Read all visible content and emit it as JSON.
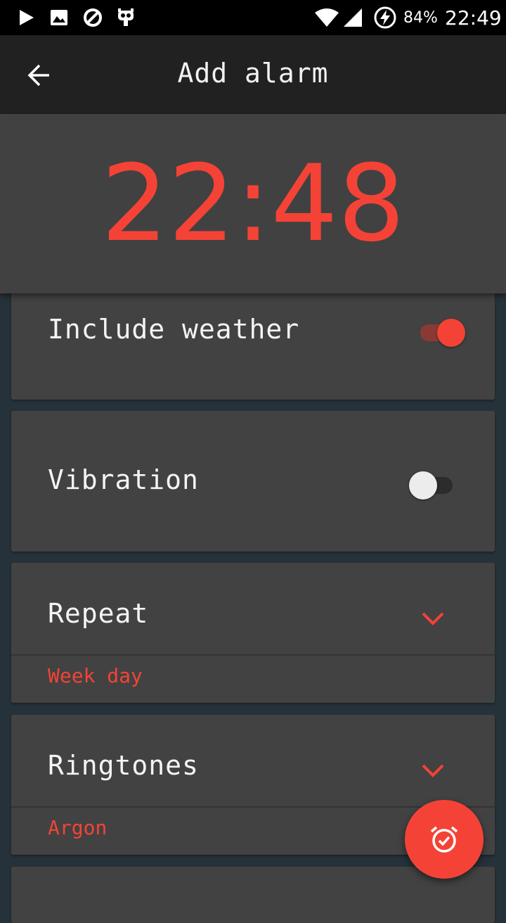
{
  "status_bar": {
    "battery": "84%",
    "time": "22:49",
    "icons": [
      "play-icon",
      "image-icon",
      "blocked-icon",
      "cyanogen-icon",
      "wifi-icon",
      "signal-icon",
      "battery-charging-icon"
    ]
  },
  "app_bar": {
    "title": "Add alarm",
    "back_icon": "arrow-back-icon"
  },
  "alarm_time": "22:48",
  "settings": {
    "weather": {
      "label": "Include weather",
      "enabled": true
    },
    "vibration": {
      "label": "Vibration",
      "enabled": false
    },
    "repeat": {
      "label": "Repeat",
      "value": "Week day"
    },
    "ringtones": {
      "label": "Ringtones",
      "value": "Argon"
    }
  },
  "fab_icon": "alarm-check-icon",
  "colors": {
    "accent": "#f44336",
    "card": "#424242",
    "background": "#26323a",
    "app_bar": "#212121"
  }
}
